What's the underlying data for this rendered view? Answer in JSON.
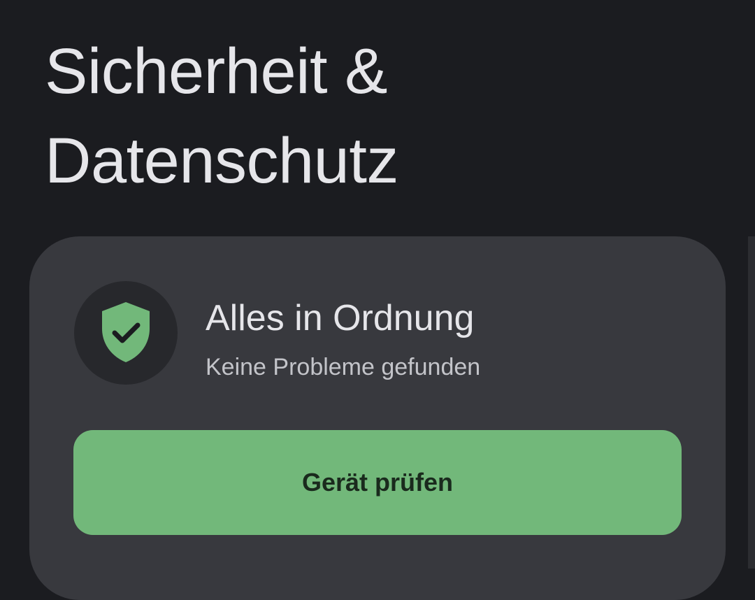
{
  "header": {
    "title_line1": "Sicherheit &",
    "title_line2": "Datenschutz"
  },
  "status_card": {
    "icon": "shield-check-icon",
    "title": "Alles in Ordnung",
    "subtitle": "Keine Probleme gefunden",
    "action_label": "Gerät prüfen"
  },
  "colors": {
    "background": "#1b1c20",
    "card": "#38393e",
    "accent_green": "#72b87a",
    "icon_circle": "#27282c"
  }
}
